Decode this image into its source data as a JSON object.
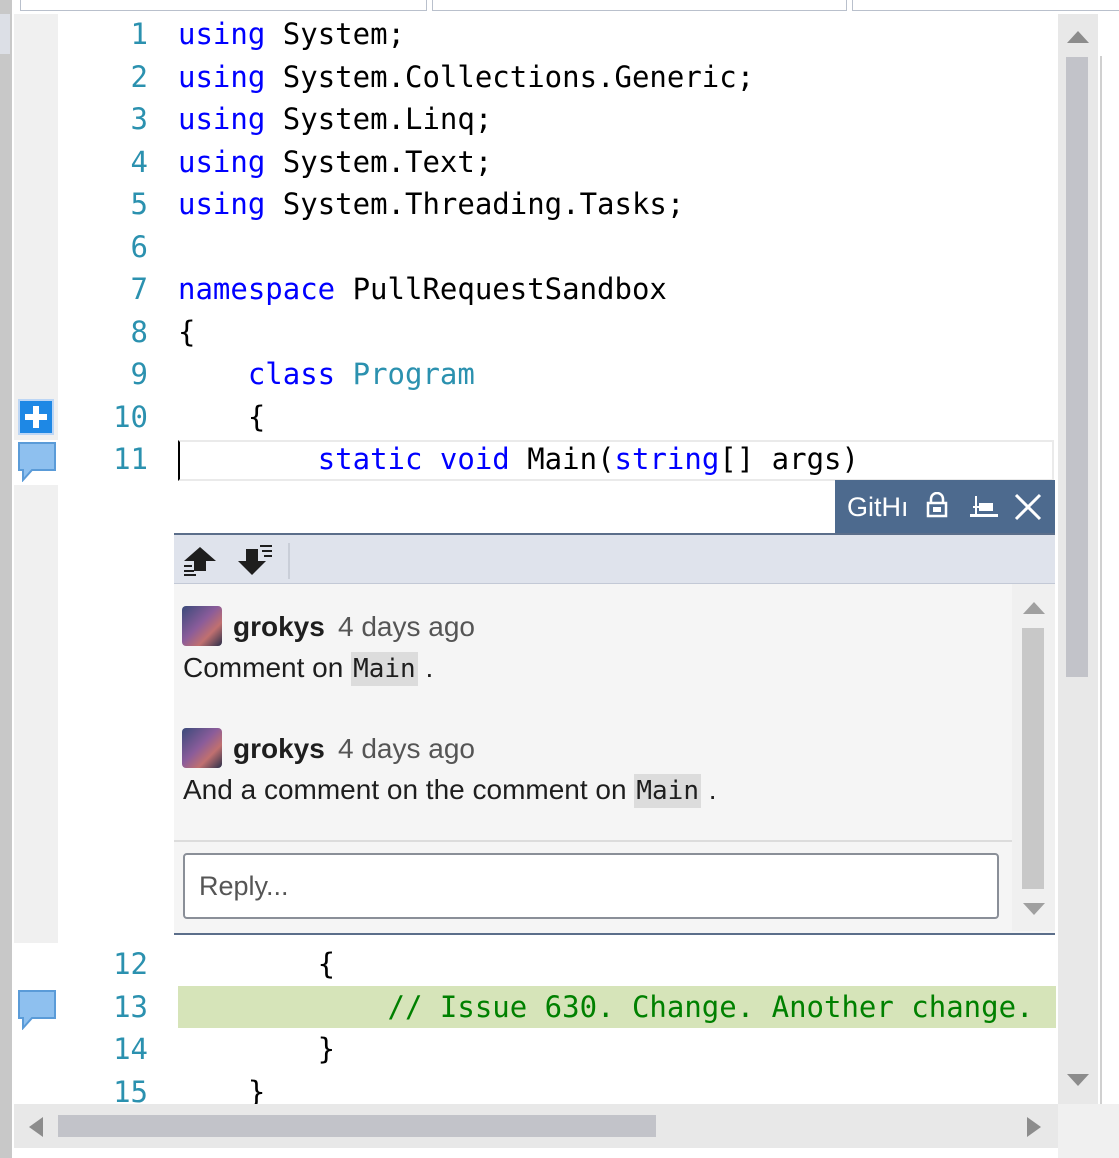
{
  "editor": {
    "lines": [
      {
        "num": "1",
        "t": [
          {
            "k": "kw",
            "v": "using"
          },
          {
            "k": "",
            "v": " System;"
          }
        ]
      },
      {
        "num": "2",
        "t": [
          {
            "k": "kw",
            "v": "using"
          },
          {
            "k": "",
            "v": " System.Collections.Generic;"
          }
        ]
      },
      {
        "num": "3",
        "t": [
          {
            "k": "kw",
            "v": "using"
          },
          {
            "k": "",
            "v": " System.Linq;"
          }
        ]
      },
      {
        "num": "4",
        "t": [
          {
            "k": "kw",
            "v": "using"
          },
          {
            "k": "",
            "v": " System.Text;"
          }
        ]
      },
      {
        "num": "5",
        "t": [
          {
            "k": "kw",
            "v": "using"
          },
          {
            "k": "",
            "v": " System.Threading.Tasks;"
          }
        ]
      },
      {
        "num": "6",
        "t": []
      },
      {
        "num": "7",
        "t": [
          {
            "k": "kw",
            "v": "namespace"
          },
          {
            "k": "",
            "v": " PullRequestSandbox"
          }
        ]
      },
      {
        "num": "8",
        "t": [
          {
            "k": "",
            "v": "{"
          }
        ]
      },
      {
        "num": "9",
        "t": [
          {
            "k": "",
            "v": "    "
          },
          {
            "k": "kw",
            "v": "class"
          },
          {
            "k": "",
            "v": " "
          },
          {
            "k": "ty",
            "v": "Program"
          }
        ]
      },
      {
        "num": "10",
        "t": [
          {
            "k": "",
            "v": "    {"
          }
        ]
      },
      {
        "num": "11",
        "t": [
          {
            "k": "",
            "v": "        "
          },
          {
            "k": "kw",
            "v": "static"
          },
          {
            "k": "",
            "v": " "
          },
          {
            "k": "kw",
            "v": "void"
          },
          {
            "k": "",
            "v": " Main("
          },
          {
            "k": "kw",
            "v": "string"
          },
          {
            "k": "",
            "v": "[] args)"
          }
        ]
      },
      {
        "num": "12",
        "t": [
          {
            "k": "",
            "v": "        {"
          }
        ]
      },
      {
        "num": "13",
        "t": [
          {
            "k": "",
            "v": "            "
          },
          {
            "k": "cm",
            "v": "// Issue 630. Change. Another change."
          }
        ]
      },
      {
        "num": "14",
        "t": [
          {
            "k": "",
            "v": "        }"
          }
        ]
      },
      {
        "num": "15",
        "t": [
          {
            "k": "",
            "v": "    }"
          }
        ]
      }
    ]
  },
  "peek": {
    "title": "GitHı",
    "comments": [
      {
        "author": "grokys",
        "time": "4 days ago",
        "body_before": "Comment on ",
        "code": "Main",
        "body_after": " ."
      },
      {
        "author": "grokys",
        "time": "4 days ago",
        "body_before": "And a comment on the comment on ",
        "code": "Main",
        "body_after": " ."
      }
    ],
    "reply_placeholder": "Reply..."
  },
  "icons": {
    "add_comment": "plus-icon",
    "comment_bubble": "comment-icon",
    "prev_comment": "previous-comment-icon",
    "next_comment": "next-comment-icon",
    "lock": "lock-icon",
    "pin": "pin-icon",
    "close": "close-icon"
  },
  "colors": {
    "peek_header": "#4d6a8e",
    "line_number": "#2b91af",
    "keyword": "#0000ff",
    "comment": "#008000",
    "diff_added_bg": "#d6e4b9"
  }
}
